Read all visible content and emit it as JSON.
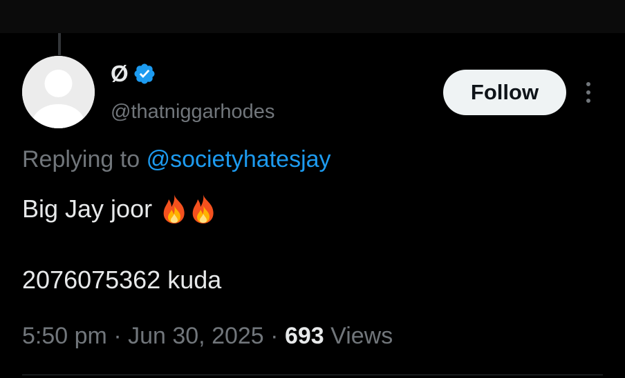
{
  "user": {
    "display_name": "Ø",
    "handle": "@thatniggarhodes",
    "verified_icon": "verified-badge-icon",
    "avatar_icon": "default-avatar-icon"
  },
  "actions": {
    "follow_label": "Follow",
    "more_icon": "vertical-ellipsis-icon"
  },
  "reply": {
    "prefix": "Replying to",
    "to_handle": "@societyhatesjay"
  },
  "tweet": {
    "line1_text": "Big Jay joor",
    "line1_emojis": [
      "fire-icon",
      "fire-icon"
    ],
    "line2_text": "2076075362 kuda"
  },
  "meta": {
    "time": "5:50 pm",
    "separator": "·",
    "date": "Jun 30, 2025",
    "views_count": "693",
    "views_label": "Views"
  },
  "colors": {
    "background": "#000000",
    "text_primary": "#e7e9ea",
    "text_secondary": "#71767b",
    "accent_blue": "#1d9bf0",
    "follow_bg": "#eff3f4",
    "divider": "#2f3336"
  }
}
